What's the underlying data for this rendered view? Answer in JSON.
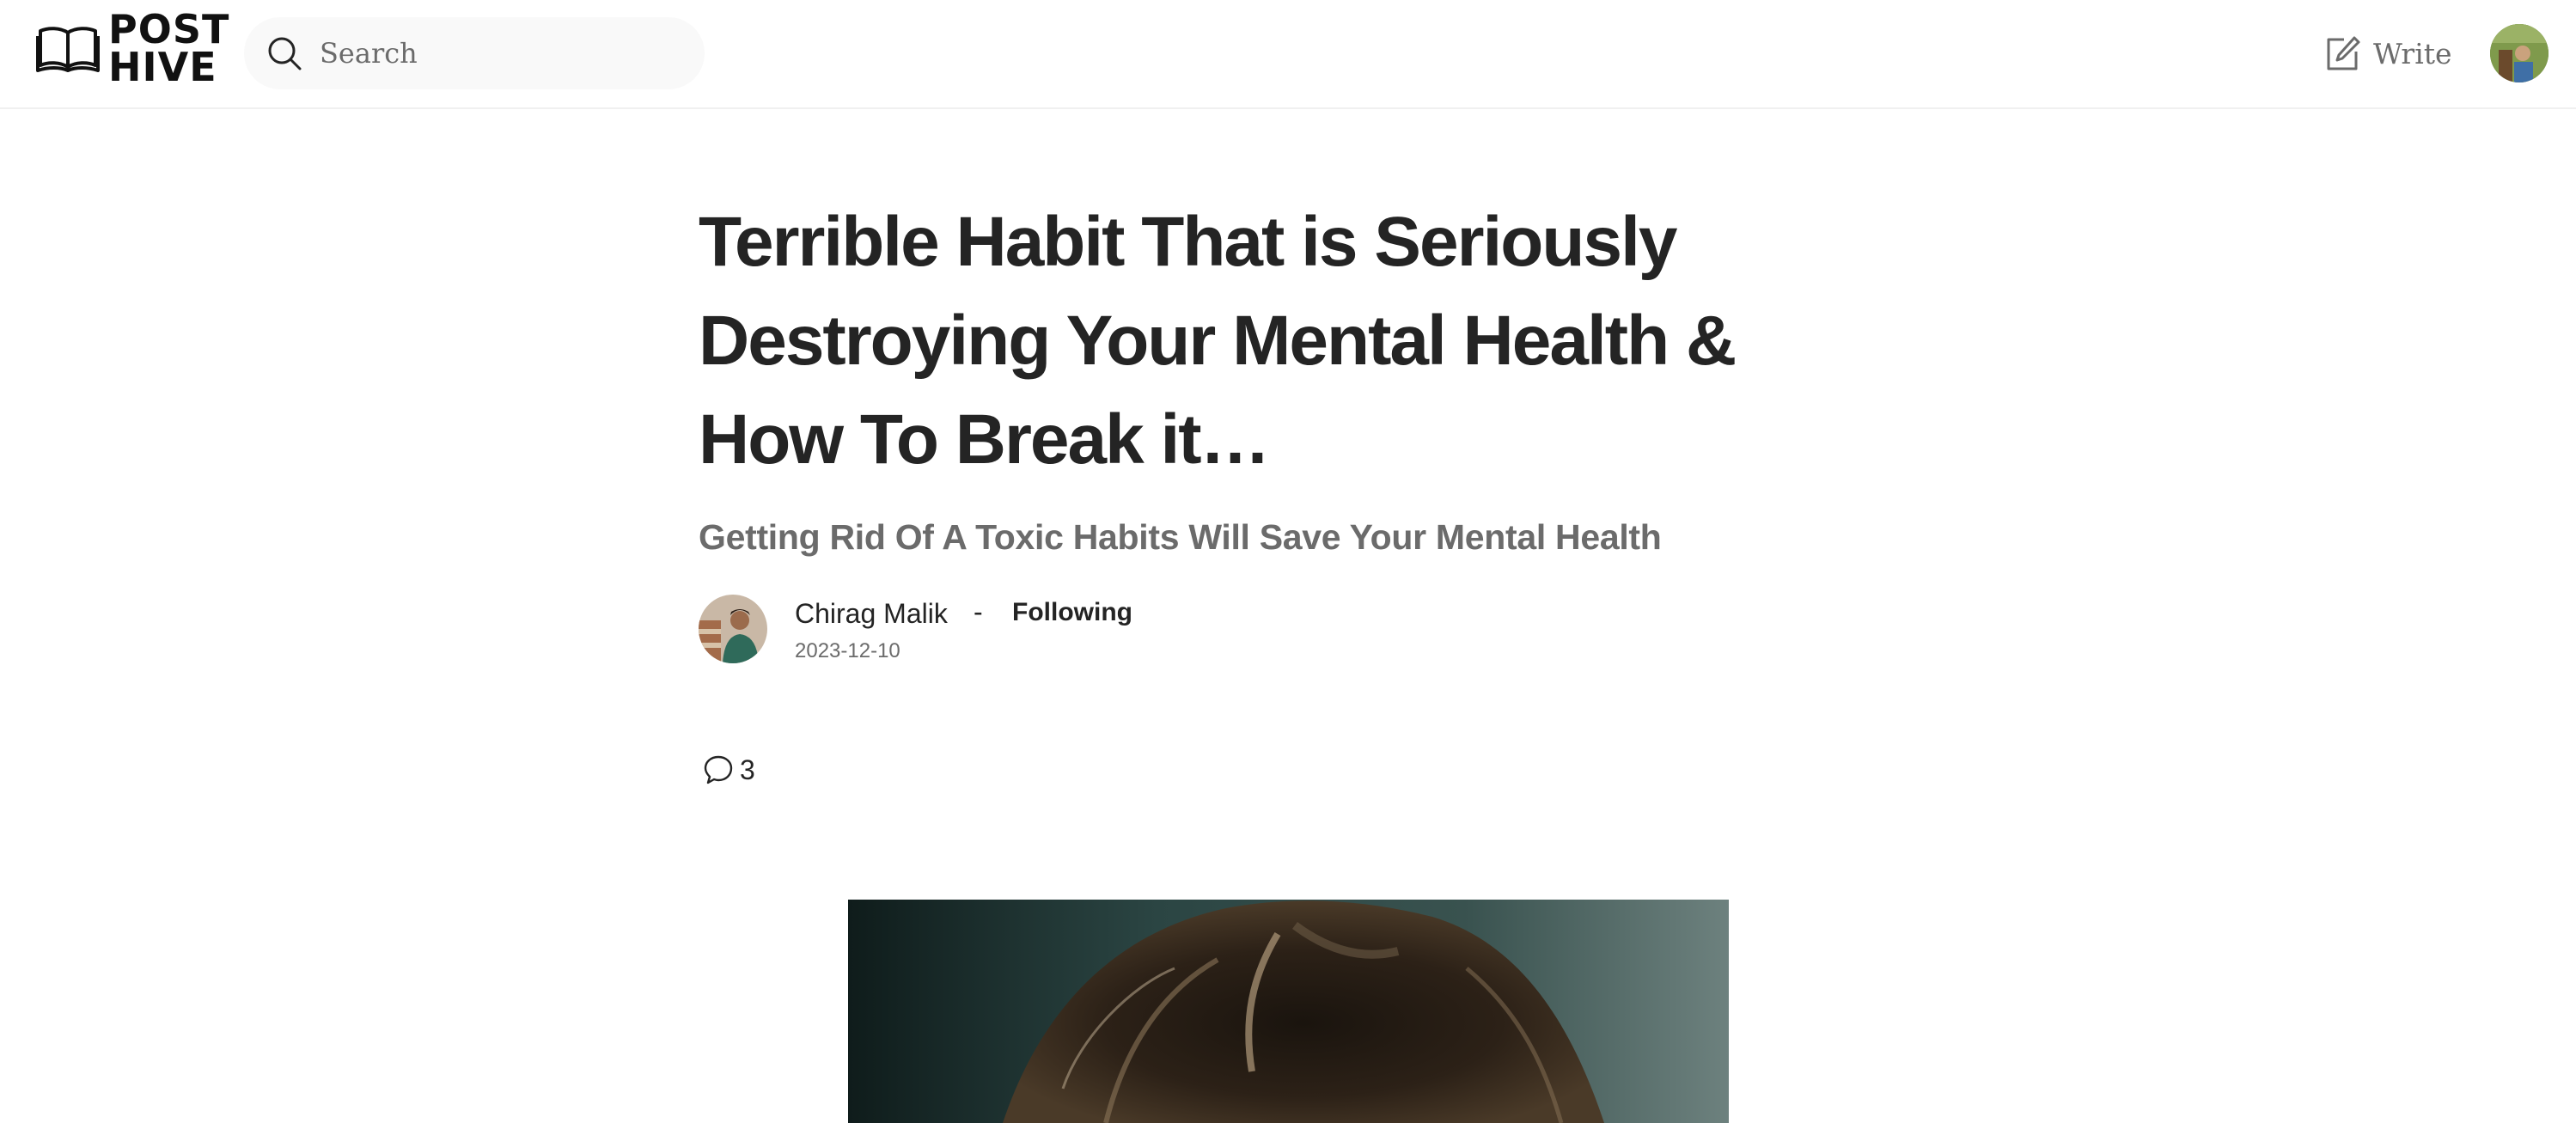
{
  "header": {
    "logo_line1": "POST",
    "logo_line2": "HIVE",
    "search_placeholder": "Search",
    "write_label": "Write"
  },
  "article": {
    "title": "Terrible Habit That is Seriously Destroying Your Mental Health & How To Break it…",
    "subtitle": "Getting Rid Of A Toxic Habits Will Save Your Mental Health",
    "author_name": "Chirag Malik",
    "separator": "-",
    "follow_status": "Following",
    "date": "2023-12-10",
    "comment_count": "3"
  },
  "icons": {
    "logo": "open-book-icon",
    "search": "search-icon",
    "write": "edit-note-icon",
    "comments": "speech-bubble-icon"
  },
  "colors": {
    "text_primary": "#242424",
    "text_secondary": "#6b6b6b",
    "search_bg": "#f9f9f9",
    "divider": "#f0f0f0"
  }
}
